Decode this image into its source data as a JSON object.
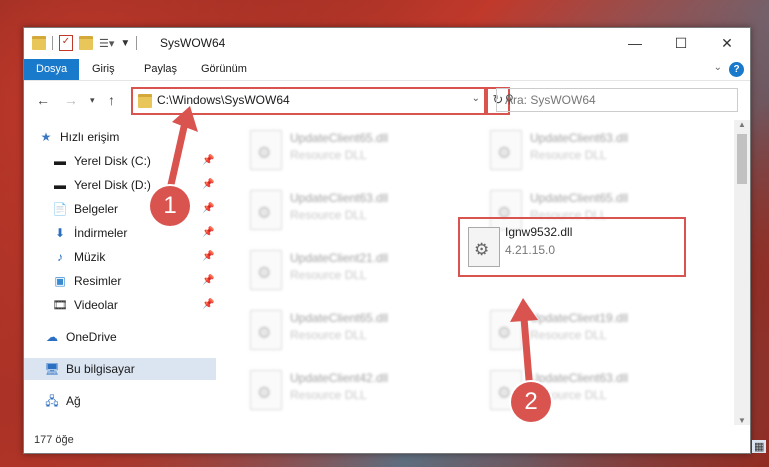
{
  "window": {
    "title": "SysWOW64"
  },
  "ribbon": {
    "tabs": [
      "Dosya",
      "Giriş",
      "Paylaş",
      "Görünüm"
    ]
  },
  "address": {
    "path": "C:\\Windows\\SysWOW64"
  },
  "search": {
    "placeholder": "Ara: SysWOW64"
  },
  "sidebar": {
    "items": [
      {
        "label": "Hızlı erişim",
        "icon": "star-icon"
      },
      {
        "label": "Yerel Disk (C:)",
        "icon": "drive-icon"
      },
      {
        "label": "Yerel Disk (D:)",
        "icon": "drive-icon"
      },
      {
        "label": "Belgeler",
        "icon": "documents-icon"
      },
      {
        "label": "İndirmeler",
        "icon": "download-icon"
      },
      {
        "label": "Müzik",
        "icon": "music-icon"
      },
      {
        "label": "Resimler",
        "icon": "pictures-icon"
      },
      {
        "label": "Videolar",
        "icon": "video-icon"
      },
      {
        "label": "OneDrive",
        "icon": "cloud-icon"
      },
      {
        "label": "Bu bilgisayar",
        "icon": "computer-icon"
      },
      {
        "label": "Ağ",
        "icon": "network-icon"
      }
    ]
  },
  "files": [
    {
      "name": "UpdateClient65.dll",
      "sub": "Resource DLL"
    },
    {
      "name": "UpdateClient63.dll",
      "sub": "Resource DLL"
    },
    {
      "name": "UpdateClient63.dll",
      "sub": "Resource DLL"
    },
    {
      "name": "UpdateClient65.dll",
      "sub": "Resource DLL"
    },
    {
      "name": "UpdateClient21.dll",
      "sub": "Resource DLL"
    },
    {
      "name": "UpdateClient65.dll",
      "sub": "Resource DLL"
    },
    {
      "name": "UpdateClient19.dll",
      "sub": "Resource DLL"
    },
    {
      "name": "UpdateClient42.dll",
      "sub": "Resource DLL"
    },
    {
      "name": "UpdateClient63.dll",
      "sub": "Resource DLL"
    }
  ],
  "highlighted_file": {
    "name": "Ignw9532.dll",
    "version": "4.21.15.0"
  },
  "status": {
    "count": "177 öğe"
  },
  "annotations": {
    "step1": "1",
    "step2": "2"
  }
}
